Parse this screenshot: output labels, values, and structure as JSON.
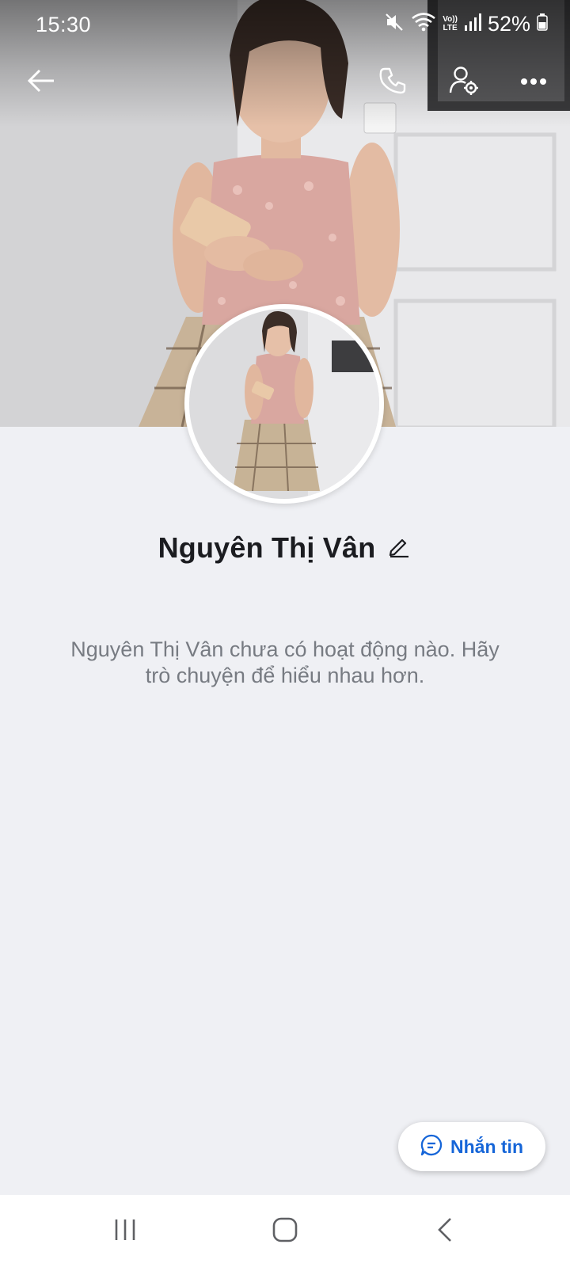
{
  "status_bar": {
    "time": "15:30",
    "battery_percent": "52%",
    "icons": [
      "mute-icon",
      "wifi-icon",
      "volte-icon",
      "signal-icon",
      "battery-icon"
    ],
    "volte_label_top": "Vo))",
    "volte_label_bottom": "LTE"
  },
  "toolbar": {
    "icons": [
      "back-arrow-icon",
      "phone-icon",
      "user-settings-icon",
      "more-options-icon"
    ]
  },
  "profile": {
    "name": "Nguyên Thị Vân",
    "edit_icon": "pencil-icon"
  },
  "empty_state": {
    "message": "Nguyên Thị Vân chưa có hoạt động nào. Hãy trò chuyện để hiểu nhau hơn."
  },
  "message_button": {
    "label": "Nhắn tin",
    "icon": "chat-bubble-icon"
  },
  "nav_bar": {
    "icons": [
      "recent-apps-icon",
      "home-icon",
      "back-icon"
    ]
  },
  "colors": {
    "accent": "#1565d8",
    "page_background": "#eff0f4",
    "name_text": "#1b1c20",
    "secondary_text": "#777b82"
  }
}
